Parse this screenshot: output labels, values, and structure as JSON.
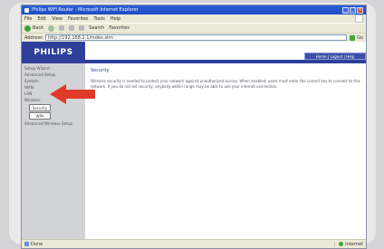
{
  "window": {
    "title": "Philips WiFi Router - Microsoft Internet Explorer",
    "minimize": "_",
    "maximize": "□",
    "close": "×"
  },
  "menu": [
    "File",
    "Edit",
    "View",
    "Favorites",
    "Tools",
    "Help"
  ],
  "toolbar": {
    "back_label": "Back",
    "search_label": "Search",
    "favorites_label": "Favorites"
  },
  "address": {
    "label": "Address",
    "value": "http://192.168.2.1/index.stm",
    "go_label": "Go"
  },
  "header": {
    "logo": "PHILIPS",
    "top_nav": "Home | Logout | Help"
  },
  "sidebar": {
    "items": [
      "Setup Wizard",
      "Advanced Setup",
      "System",
      "WAN",
      "LAN",
      "Wireless"
    ],
    "sub_buttons": [
      "Security",
      "WPA"
    ],
    "last_item": "Advanced Wireless Setup"
  },
  "main": {
    "title": "Security",
    "text": "Wireless security is needed to protect your network against unauthorized access. When enabled, users must enter the correct key to connect to this network. If you do not set security, anybody within range may be able to use your internet connection."
  },
  "status": {
    "text": "Done",
    "zone": "Internet"
  },
  "colors": {
    "accent": "#2e3f9a",
    "arrow": "#e03a2a",
    "sidebar": "#d2d3d6"
  }
}
